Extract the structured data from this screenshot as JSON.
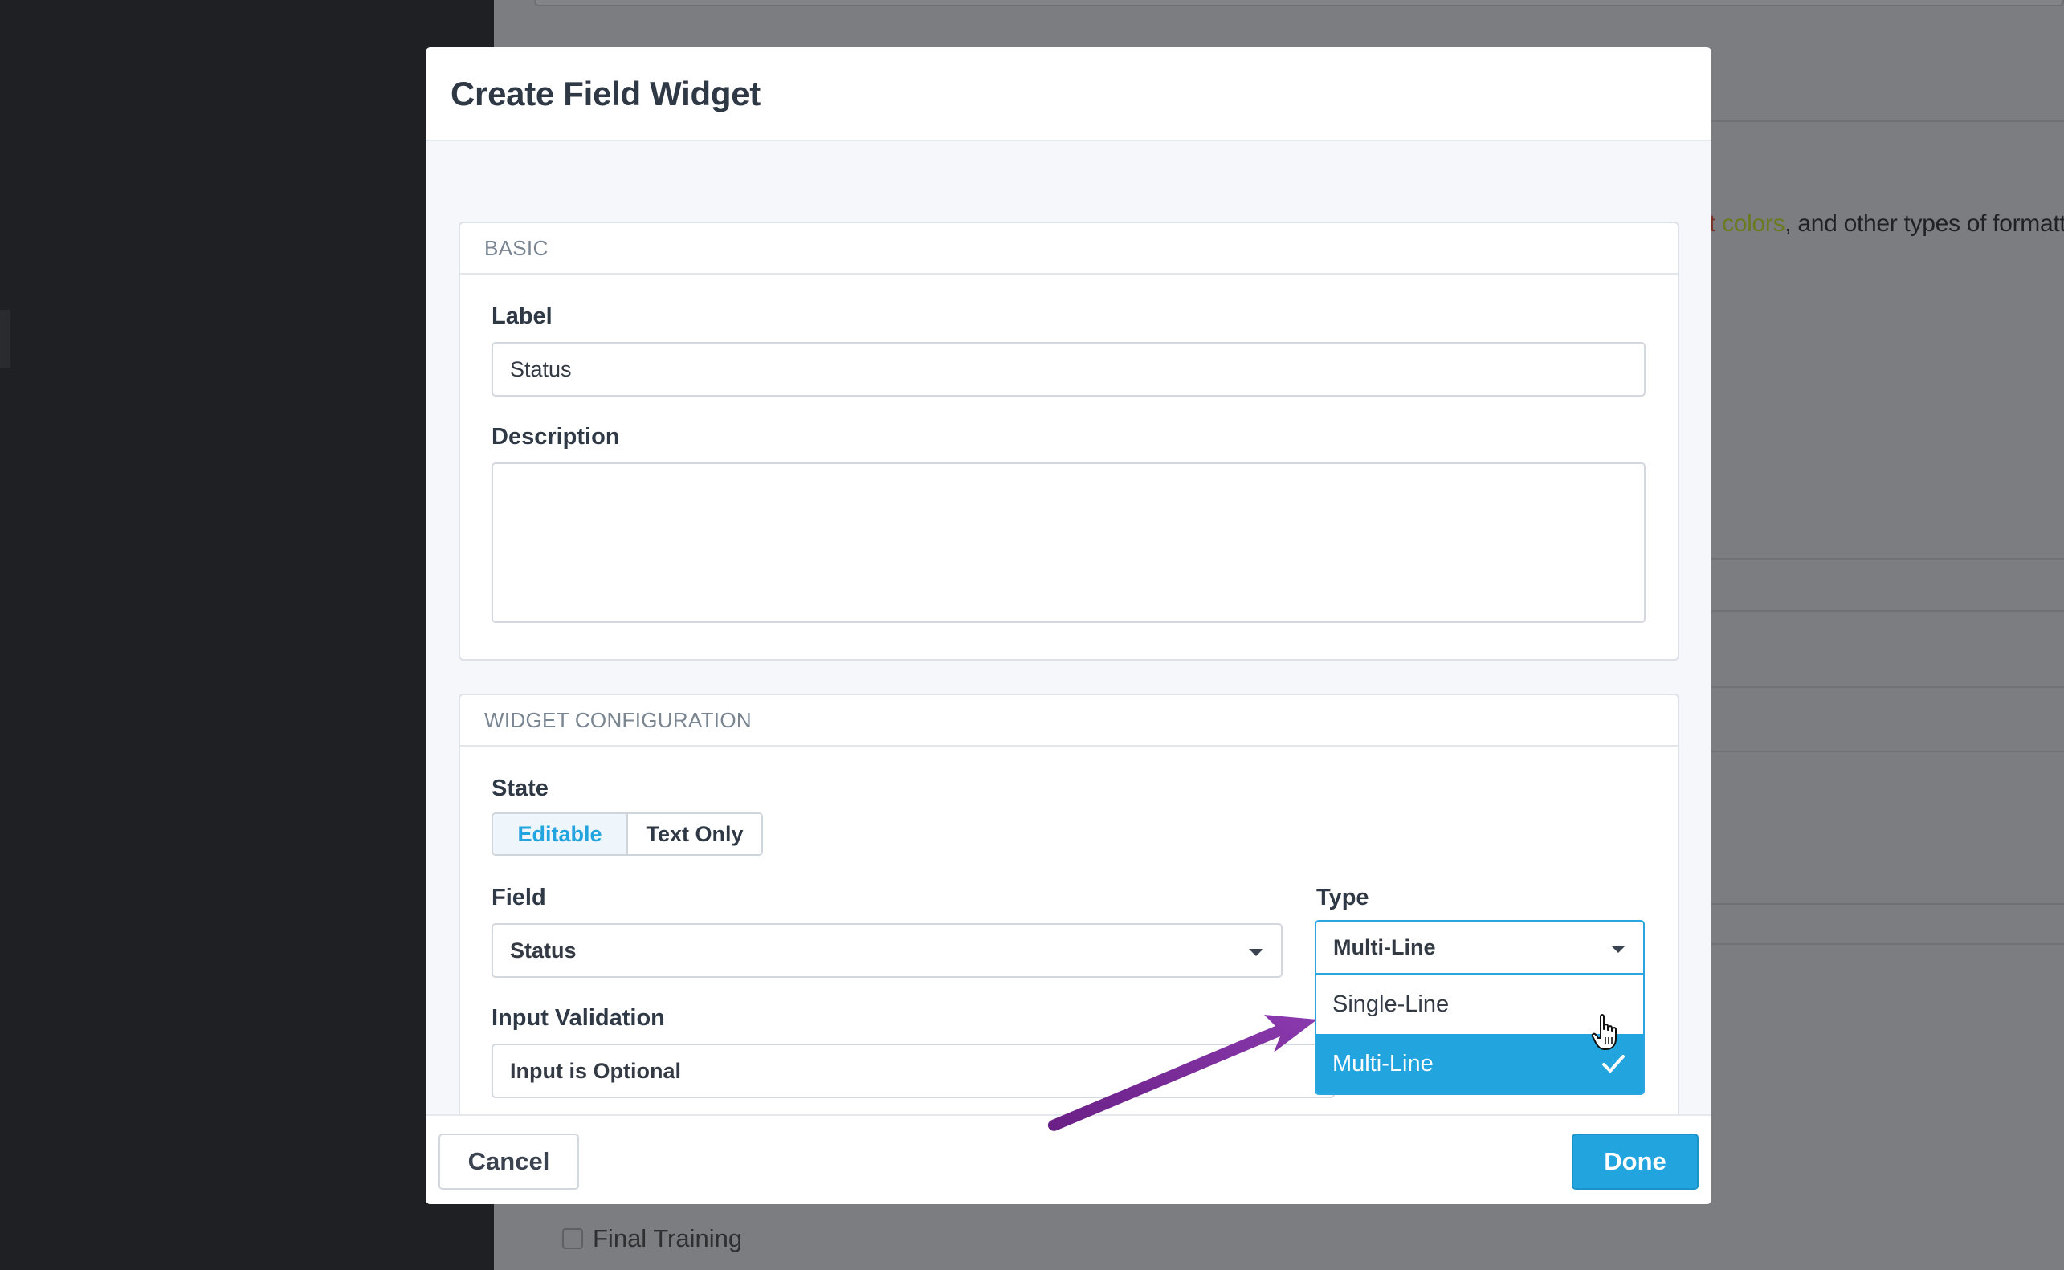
{
  "background": {
    "formatting_text_prefix": "t ",
    "formatting_text_colors": "colors",
    "formatting_text_suffix": ", and other types of formatt",
    "task_label": "Final Training"
  },
  "modal": {
    "title": "Create Field Widget",
    "basic": {
      "heading": "Basic",
      "label_label": "Label",
      "label_value": "Status",
      "description_label": "Description",
      "description_value": ""
    },
    "widget_config": {
      "heading": "Widget Configuration",
      "state_label": "State",
      "state_options": [
        "Editable",
        "Text Only"
      ],
      "state_selected": "Editable",
      "field_label": "Field",
      "field_value": "Status",
      "type_label": "Type",
      "type_value": "Multi-Line",
      "type_options": [
        "Single-Line",
        "Multi-Line"
      ],
      "type_selected": "Multi-Line",
      "validation_label": "Input Validation",
      "validation_value": "Input is Optional"
    },
    "footer": {
      "cancel_label": "Cancel",
      "done_label": "Done"
    }
  },
  "colors": {
    "accent": "#22a4de",
    "annotation_arrow": "#7b2f9c",
    "modal_body_bg": "#f5f7fa",
    "backdrop": "#7c7d80"
  },
  "icons": [
    "caret-down-icon",
    "checkmark-icon",
    "hand-pointer-cursor-icon",
    "annotation-arrow"
  ]
}
